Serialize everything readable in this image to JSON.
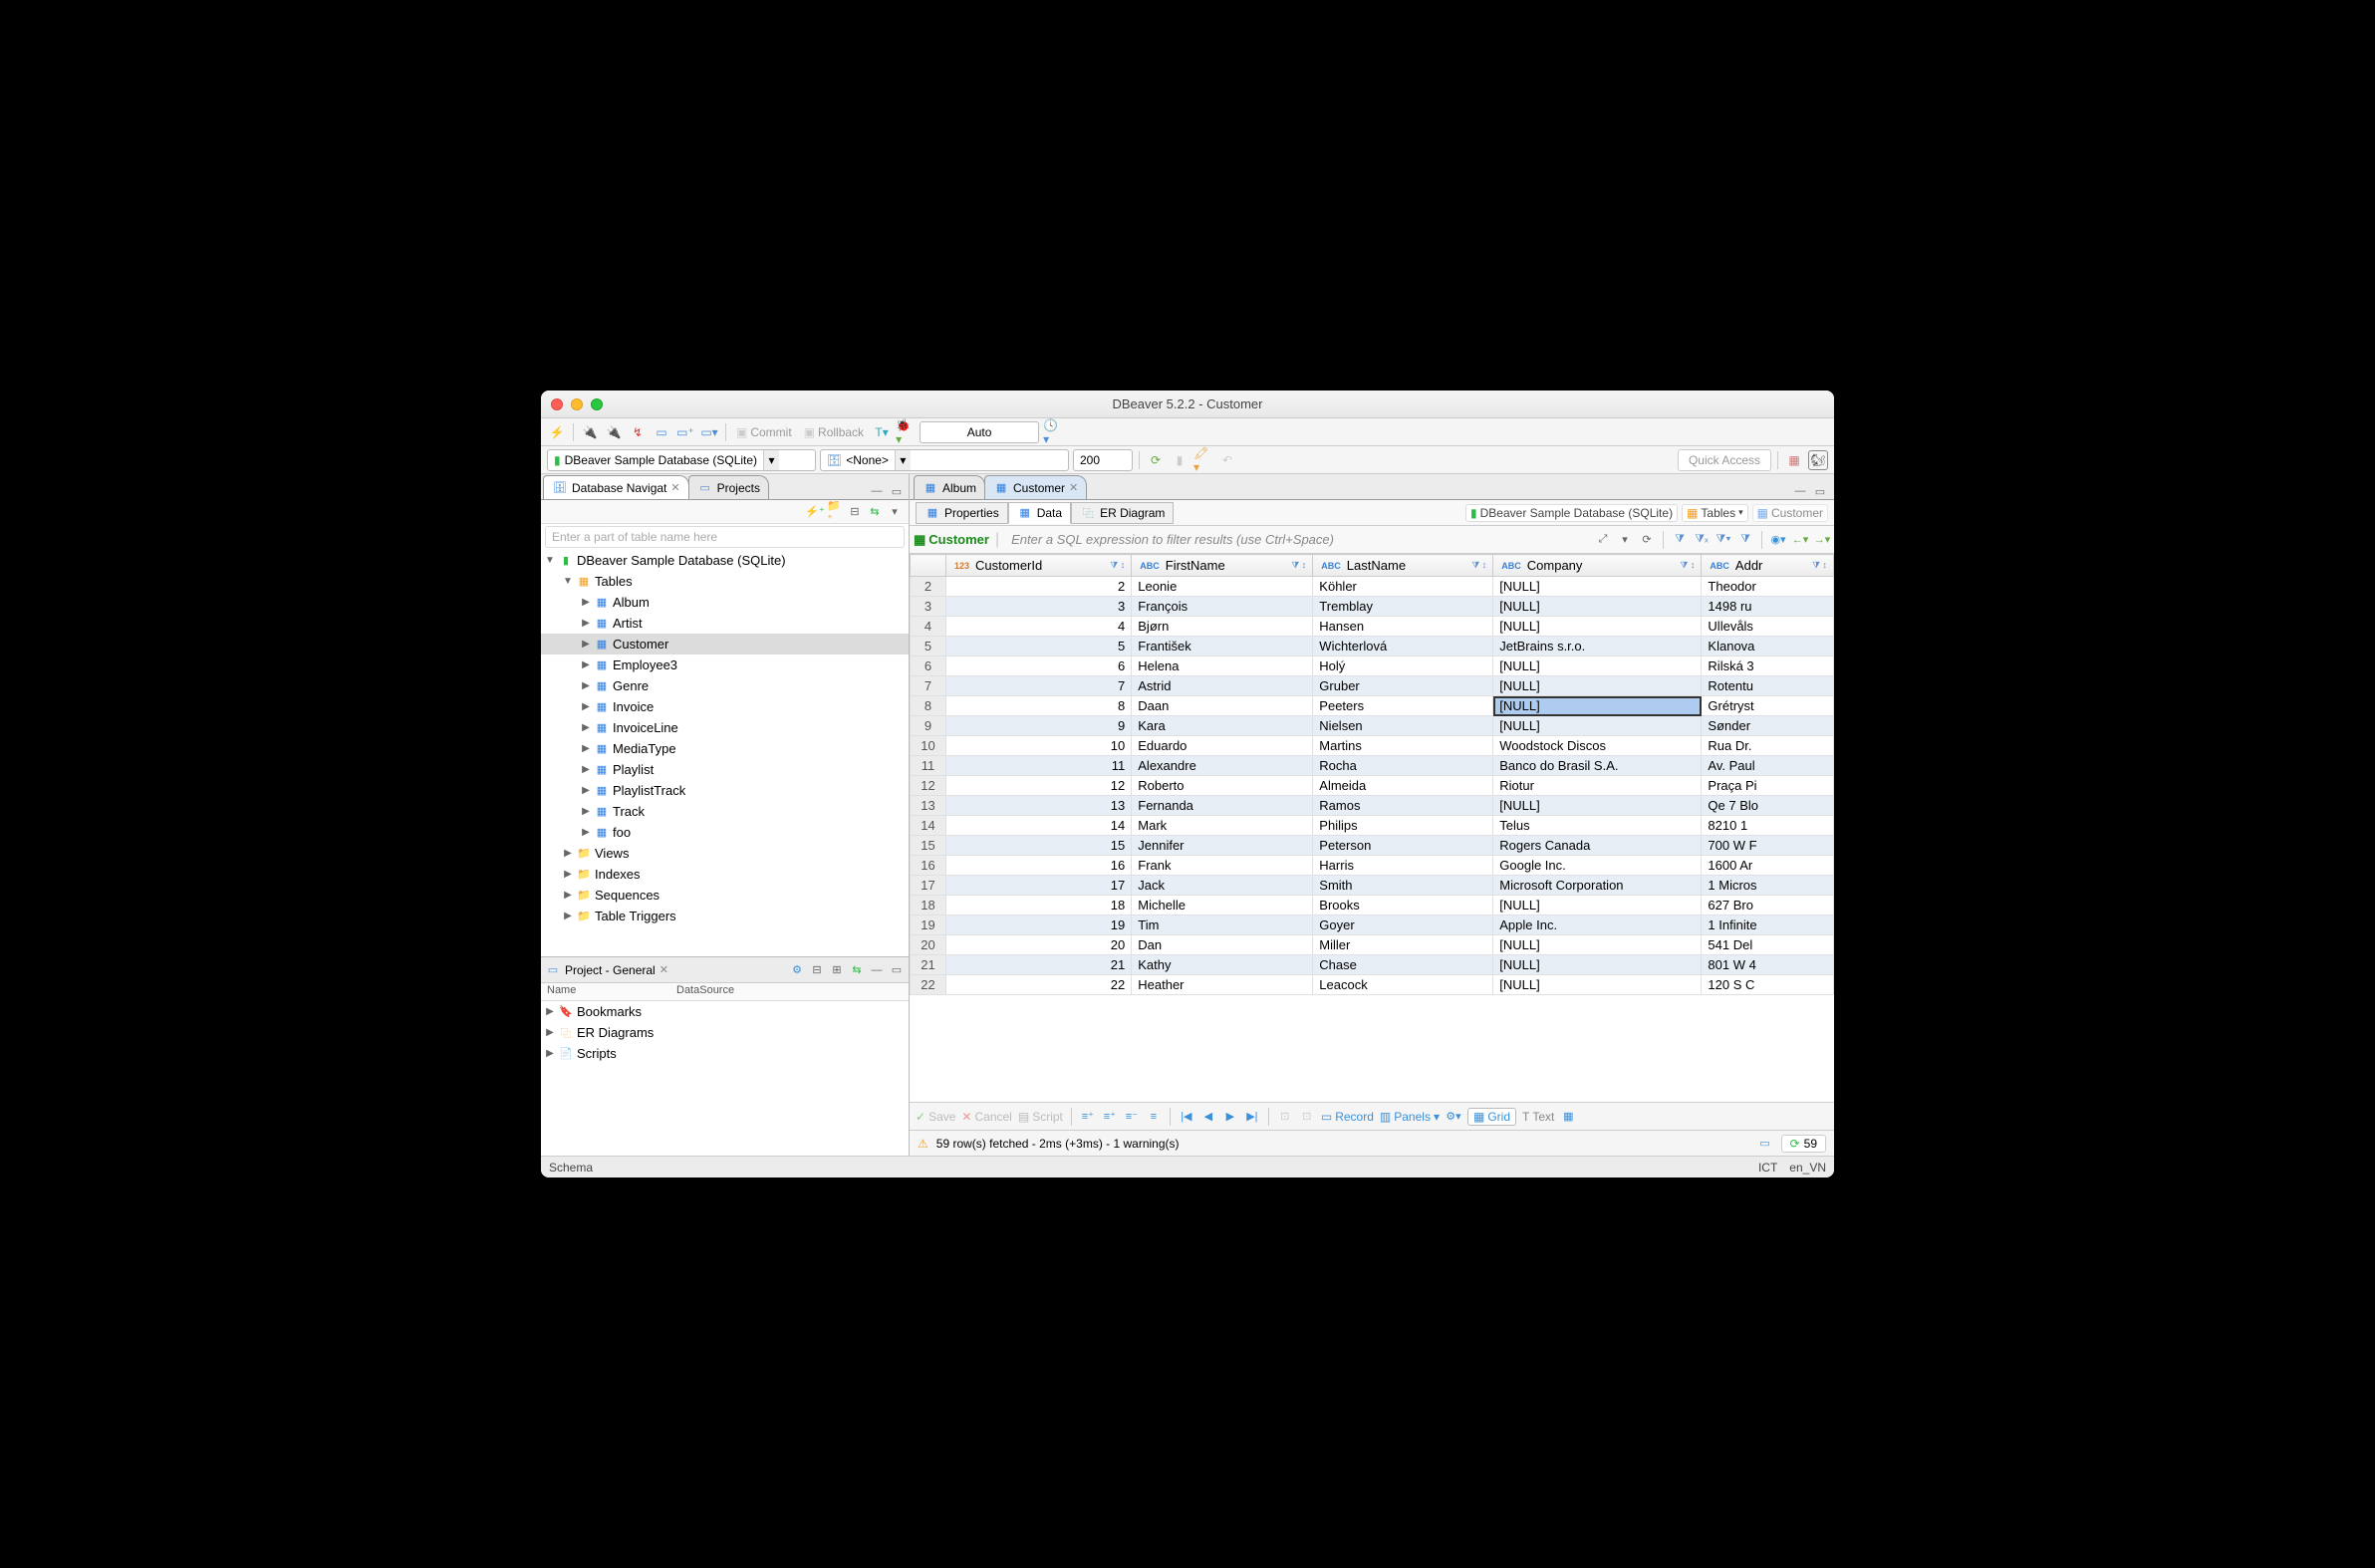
{
  "window_title": "DBeaver 5.2.2 - Customer",
  "toolbar": {
    "commit": "Commit",
    "rollback": "Rollback",
    "txn_mode": "Auto",
    "quick_access": "Quick Access"
  },
  "datasource_bar": {
    "datasource": "DBeaver Sample Database (SQLite)",
    "schema": "<None>",
    "limit": "200"
  },
  "nav_panel": {
    "tab1": "Database Navigat",
    "tab2": "Projects",
    "filter_placeholder": "Enter a part of table name here",
    "root": "DBeaver Sample Database (SQLite)",
    "tables_label": "Tables",
    "tables": [
      "Album",
      "Artist",
      "Customer",
      "Employee3",
      "Genre",
      "Invoice",
      "InvoiceLine",
      "MediaType",
      "Playlist",
      "PlaylistTrack",
      "Track",
      "foo"
    ],
    "views": "Views",
    "indexes": "Indexes",
    "sequences": "Sequences",
    "triggers": "Table Triggers"
  },
  "project_panel": {
    "title": "Project - General",
    "col1": "Name",
    "col2": "DataSource",
    "items": [
      "Bookmarks",
      "ER Diagrams",
      "Scripts"
    ]
  },
  "editor": {
    "tab_album": "Album",
    "tab_customer": "Customer",
    "sub_properties": "Properties",
    "sub_data": "Data",
    "sub_er": "ER Diagram",
    "crumb_ds": "DBeaver Sample Database (SQLite)",
    "crumb_tables": "Tables",
    "crumb_table": "Customer",
    "entity": "Customer",
    "filter_hint": "Enter a SQL expression to filter results (use Ctrl+Space)"
  },
  "grid": {
    "columns": [
      "CustomerId",
      "FirstName",
      "LastName",
      "Company",
      "Addr"
    ],
    "col_types": [
      "num",
      "str",
      "str",
      "str",
      "str"
    ],
    "rows": [
      {
        "n": 2,
        "CustomerId": 2,
        "FirstName": "Leonie",
        "LastName": "Köhler",
        "Company": "[NULL]",
        "Addr": "Theodor"
      },
      {
        "n": 3,
        "CustomerId": 3,
        "FirstName": "François",
        "LastName": "Tremblay",
        "Company": "[NULL]",
        "Addr": "1498 ru"
      },
      {
        "n": 4,
        "CustomerId": 4,
        "FirstName": "Bjørn",
        "LastName": "Hansen",
        "Company": "[NULL]",
        "Addr": "Ullevåls"
      },
      {
        "n": 5,
        "CustomerId": 5,
        "FirstName": "František",
        "LastName": "Wichterlová",
        "Company": "JetBrains s.r.o.",
        "Addr": "Klanova"
      },
      {
        "n": 6,
        "CustomerId": 6,
        "FirstName": "Helena",
        "LastName": "Holý",
        "Company": "[NULL]",
        "Addr": "Rilská 3"
      },
      {
        "n": 7,
        "CustomerId": 7,
        "FirstName": "Astrid",
        "LastName": "Gruber",
        "Company": "[NULL]",
        "Addr": "Rotentu"
      },
      {
        "n": 8,
        "CustomerId": 8,
        "FirstName": "Daan",
        "LastName": "Peeters",
        "Company": "[NULL]",
        "Addr": "Grétryst"
      },
      {
        "n": 9,
        "CustomerId": 9,
        "FirstName": "Kara",
        "LastName": "Nielsen",
        "Company": "[NULL]",
        "Addr": "Sønder"
      },
      {
        "n": 10,
        "CustomerId": 10,
        "FirstName": "Eduardo",
        "LastName": "Martins",
        "Company": "Woodstock Discos",
        "Addr": "Rua Dr."
      },
      {
        "n": 11,
        "CustomerId": 11,
        "FirstName": "Alexandre",
        "LastName": "Rocha",
        "Company": "Banco do Brasil S.A.",
        "Addr": "Av. Paul"
      },
      {
        "n": 12,
        "CustomerId": 12,
        "FirstName": "Roberto",
        "LastName": "Almeida",
        "Company": "Riotur",
        "Addr": "Praça Pi"
      },
      {
        "n": 13,
        "CustomerId": 13,
        "FirstName": "Fernanda",
        "LastName": "Ramos",
        "Company": "[NULL]",
        "Addr": "Qe 7 Blo"
      },
      {
        "n": 14,
        "CustomerId": 14,
        "FirstName": "Mark",
        "LastName": "Philips",
        "Company": "Telus",
        "Addr": "8210 1"
      },
      {
        "n": 15,
        "CustomerId": 15,
        "FirstName": "Jennifer",
        "LastName": "Peterson",
        "Company": "Rogers Canada",
        "Addr": "700 W F"
      },
      {
        "n": 16,
        "CustomerId": 16,
        "FirstName": "Frank",
        "LastName": "Harris",
        "Company": "Google Inc.",
        "Addr": "1600 Ar"
      },
      {
        "n": 17,
        "CustomerId": 17,
        "FirstName": "Jack",
        "LastName": "Smith",
        "Company": "Microsoft Corporation",
        "Addr": "1 Micros"
      },
      {
        "n": 18,
        "CustomerId": 18,
        "FirstName": "Michelle",
        "LastName": "Brooks",
        "Company": "[NULL]",
        "Addr": "627 Bro"
      },
      {
        "n": 19,
        "CustomerId": 19,
        "FirstName": "Tim",
        "LastName": "Goyer",
        "Company": "Apple Inc.",
        "Addr": "1 Infinite"
      },
      {
        "n": 20,
        "CustomerId": 20,
        "FirstName": "Dan",
        "LastName": "Miller",
        "Company": "[NULL]",
        "Addr": "541 Del"
      },
      {
        "n": 21,
        "CustomerId": 21,
        "FirstName": "Kathy",
        "LastName": "Chase",
        "Company": "[NULL]",
        "Addr": "801 W 4"
      },
      {
        "n": 22,
        "CustomerId": 22,
        "FirstName": "Heather",
        "LastName": "Leacock",
        "Company": "[NULL]",
        "Addr": "120 S C"
      }
    ],
    "selected_row": 8,
    "selected_col": "Company"
  },
  "bottom_toolbar": {
    "save": "Save",
    "cancel": "Cancel",
    "script": "Script",
    "record": "Record",
    "panels": "Panels",
    "grid": "Grid",
    "text": "Text"
  },
  "status": {
    "fetch": "59 row(s) fetched - 2ms (+3ms) - 1 warning(s)",
    "rowcount": "59"
  },
  "footer": {
    "left": "Schema",
    "tz": "ICT",
    "locale": "en_VN"
  }
}
